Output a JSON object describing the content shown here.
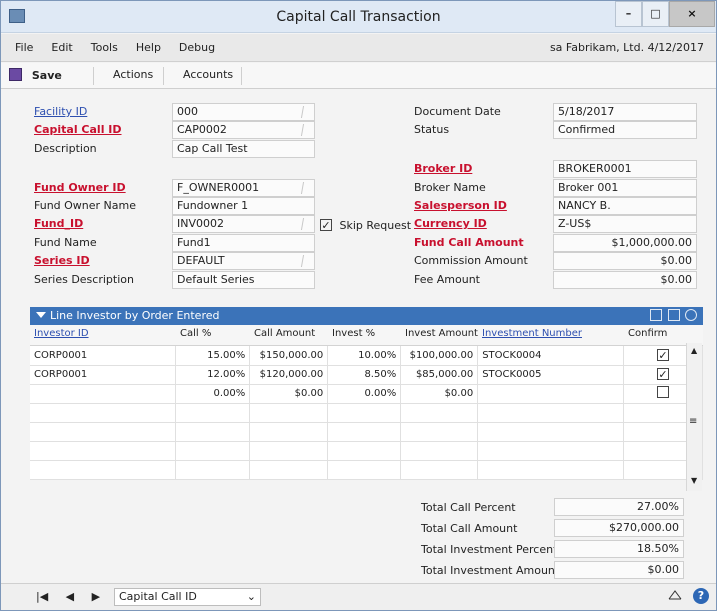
{
  "window": {
    "title": "Capital Call Transaction"
  },
  "menu": [
    "File",
    "Edit",
    "Tools",
    "Help",
    "Debug"
  ],
  "status_right": "sa  Fabrikam, Ltd.  4/12/2017",
  "toolbar": {
    "save": "Save",
    "actions": "Actions",
    "accounts": "Accounts"
  },
  "left_fields": [
    {
      "label": "Facility ID",
      "value": "000",
      "style": "link",
      "lookup": true
    },
    {
      "label": "Capital Call ID",
      "value": "CAP0002",
      "style": "req",
      "lookup": true
    },
    {
      "label": "Description",
      "value": "Cap Call Test",
      "style": "plain",
      "lookup": false
    },
    {
      "label": "Fund Owner ID",
      "value": "F_OWNER0001",
      "style": "req",
      "lookup": true
    },
    {
      "label": "Fund Owner Name",
      "value": "Fundowner 1",
      "style": "plain",
      "lookup": false
    },
    {
      "label": "Fund_ID",
      "value": "INV0002",
      "style": "req",
      "lookup": true
    },
    {
      "label": "Fund Name",
      "value": "Fund1",
      "style": "plain",
      "lookup": false
    },
    {
      "label": "Series ID",
      "value": "DEFAULT",
      "style": "req",
      "lookup": true
    },
    {
      "label": "Series Description",
      "value": "Default Series",
      "style": "plain",
      "lookup": false
    }
  ],
  "skip_request": {
    "label": "Skip Request",
    "checked": true
  },
  "right_fields": [
    {
      "label": "Document Date",
      "value": "5/18/2017"
    },
    {
      "label": "Status",
      "value": "Confirmed"
    },
    {
      "label": "Broker ID",
      "value": "BROKER0001",
      "style": "req"
    },
    {
      "label": "Broker Name",
      "value": "Broker 001",
      "style": "plain"
    },
    {
      "label": "Salesperson ID",
      "value": "NANCY B.",
      "style": "req"
    },
    {
      "label": "Currency ID",
      "value": "Z-US$",
      "style": "req"
    },
    {
      "label": "Fund Call Amount",
      "value": "$1,000,000.00",
      "style": "reqnl"
    },
    {
      "label": "Commission Amount",
      "value": "$0.00",
      "style": "plain"
    },
    {
      "label": "Fee Amount",
      "value": "$0.00",
      "style": "plain"
    }
  ],
  "grid": {
    "caption": "Line Investor by Order Entered",
    "columns": [
      "Investor ID",
      "Call %",
      "Call Amount",
      "Invest %",
      "Invest Amount",
      "Investment Number",
      "Confirm"
    ],
    "rows": [
      [
        "CORP0001",
        "15.00%",
        "$150,000.00",
        "10.00%",
        "$100,000.00",
        "STOCK0004",
        true
      ],
      [
        "CORP0001",
        "12.00%",
        "$120,000.00",
        "8.50%",
        "$85,000.00",
        "STOCK0005",
        true
      ],
      [
        "",
        "0.00%",
        "$0.00",
        "0.00%",
        "$0.00",
        "",
        false
      ],
      [
        "",
        "",
        "",
        "",
        "",
        "",
        null
      ],
      [
        "",
        "",
        "",
        "",
        "",
        "",
        null
      ],
      [
        "",
        "",
        "",
        "",
        "",
        "",
        null
      ],
      [
        "",
        "",
        "",
        "",
        "",
        "",
        null
      ]
    ]
  },
  "totals": [
    {
      "label": "Total Call Percent",
      "value": "27.00%"
    },
    {
      "label": "Total Call Amount",
      "value": "$270,000.00"
    },
    {
      "label": "Total Investment Percent",
      "value": "18.50%"
    },
    {
      "label": "Total Investment Amount",
      "value": "$0.00"
    }
  ],
  "bottom": {
    "sort_by": "Capital Call ID"
  },
  "colors": {
    "accent": "#3b73b9",
    "required": "#c8102e",
    "link": "#2d4fb0"
  }
}
